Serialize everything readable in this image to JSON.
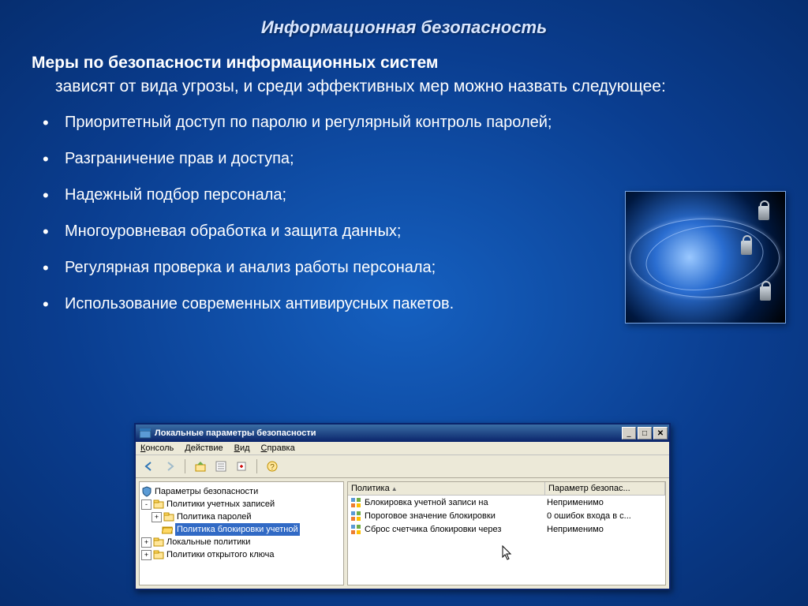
{
  "title": "Информационная безопасность",
  "heading": "Меры по безопасности информационных систем",
  "intro": "зависят от вида угрозы, и среди эффективных мер можно назвать следующее:",
  "bullets": [
    "Приоритетный доступ по паролю и регулярный контроль паролей;",
    "Разграничение прав и доступа;",
    "Надежный подбор персонала;",
    "Многоуровневая обработка и защита данных;",
    "Регулярная проверка и анализ работы персонала;",
    "Использование современных антивирусных пакетов."
  ],
  "win": {
    "title": "Локальные параметры безопасности",
    "window_buttons": {
      "min": "_",
      "max": "□",
      "close": "✕"
    },
    "menu": {
      "file": "Консоль",
      "action": "Действие",
      "view": "Вид",
      "help": "Справка"
    },
    "toolbar_icons": [
      "back",
      "forward",
      "up",
      "sep",
      "props",
      "copy",
      "sep",
      "refresh",
      "help"
    ],
    "tree": [
      {
        "level": 0,
        "expander": "",
        "icon": "shield",
        "label": "Параметры безопасности"
      },
      {
        "level": 0,
        "expander": "-",
        "icon": "folder",
        "label": "Политики учетных записей"
      },
      {
        "level": 1,
        "expander": "+",
        "icon": "folder",
        "label": "Политика паролей"
      },
      {
        "level": 1,
        "expander": "",
        "icon": "folder",
        "label": "Политика блокировки учетной",
        "selected": true
      },
      {
        "level": 0,
        "expander": "+",
        "icon": "folder",
        "label": "Локальные политики"
      },
      {
        "level": 0,
        "expander": "+",
        "icon": "folder",
        "label": "Политики открытого ключа"
      }
    ],
    "columns": {
      "c1": "Политика",
      "sort": "▲",
      "c2": "Параметр безопас..."
    },
    "rows": [
      {
        "policy": "Блокировка учетной записи на",
        "value": "Неприменимо"
      },
      {
        "policy": "Пороговое значение блокировки",
        "value": "0 ошибок входа в с..."
      },
      {
        "policy": "Сброс счетчика блокировки через",
        "value": "Неприменимо"
      }
    ]
  }
}
